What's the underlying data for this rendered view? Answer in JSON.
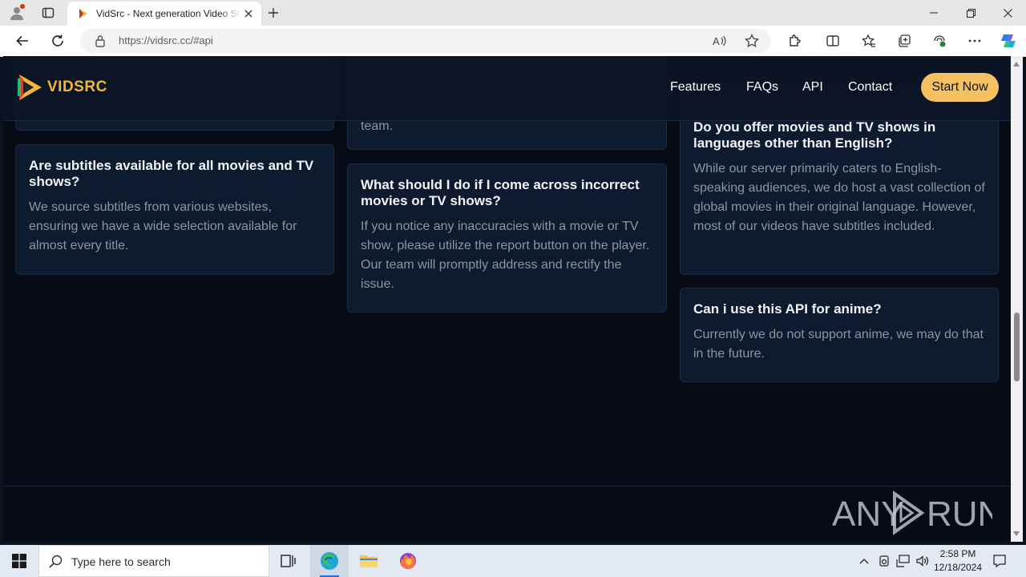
{
  "browser": {
    "tab_title": "VidSrc - Next generation Video Streaming API",
    "url": "https://vidsrc.cc/#api",
    "accent": "#1a73e8"
  },
  "site": {
    "logo_text": "VIDSRC",
    "brand_color": "#f5b731",
    "nav": {
      "features": "Features",
      "faqs": "FAQs",
      "api": "API",
      "contact": "Contact",
      "start": "Start Now"
    }
  },
  "faq": {
    "col1_top_text": "",
    "col2_top_text": "team.",
    "subtitles": {
      "question": "Are subtitles available for all movies and TV shows?",
      "answer": "We source subtitles from various websites, ensuring we have a wide selection available for almost every title."
    },
    "incorrect": {
      "question": "What should I do if I come across incorrect movies or TV shows?",
      "answer": "If you notice any inaccuracies with a movie or TV show, please utilize the report button on the player. Our team will promptly address and rectify the issue."
    },
    "languages": {
      "question": "Do you offer movies and TV shows in languages other than English?",
      "answer": "While our server primarily caters to English-speaking audiences, we do host a vast collection of global movies in their original language. However, most of our videos have subtitles included."
    },
    "anime": {
      "question": "Can i use this API for anime?",
      "answer": "Currently we do not support anime, we may do that in the future."
    }
  },
  "watermark": {
    "text": "ANY RUN"
  },
  "taskbar": {
    "search_placeholder": "Type here to search",
    "time": "2:58 PM",
    "date": "12/18/2024"
  }
}
